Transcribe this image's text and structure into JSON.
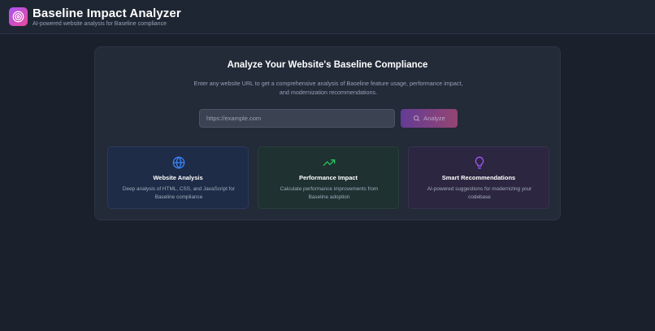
{
  "header": {
    "title": "Baseline Impact Analyzer",
    "subtitle": "AI-powered website analysis for Baseline compliance",
    "logo_icon": "target-icon"
  },
  "analyzer": {
    "heading": "Analyze Your Website's Baseline Compliance",
    "description": "Enter any website URL to get a comprehensive analysis of Baseline feature usage, performance impact, and modernization recommendations.",
    "url_placeholder": "https://example.com",
    "url_value": "",
    "analyze_label": "Analyze",
    "analyze_icon": "search-icon"
  },
  "features": [
    {
      "icon": "globe-icon",
      "title": "Website Analysis",
      "description": "Deep analysis of HTML, CSS, and JavaScript for Baseline compliance",
      "color": "#3b82f6"
    },
    {
      "icon": "trending-up-icon",
      "title": "Performance Impact",
      "description": "Calculate performance improvements from Baseline adoption",
      "color": "#22c55e"
    },
    {
      "icon": "lightbulb-icon",
      "title": "Smart Recommendations",
      "description": "AI-powered suggestions for modernizing your codebase",
      "color": "#a855f7"
    }
  ],
  "colors": {
    "background": "#1a202c",
    "accent_gradient_start": "#a855f7",
    "accent_gradient_end": "#ec4899"
  }
}
